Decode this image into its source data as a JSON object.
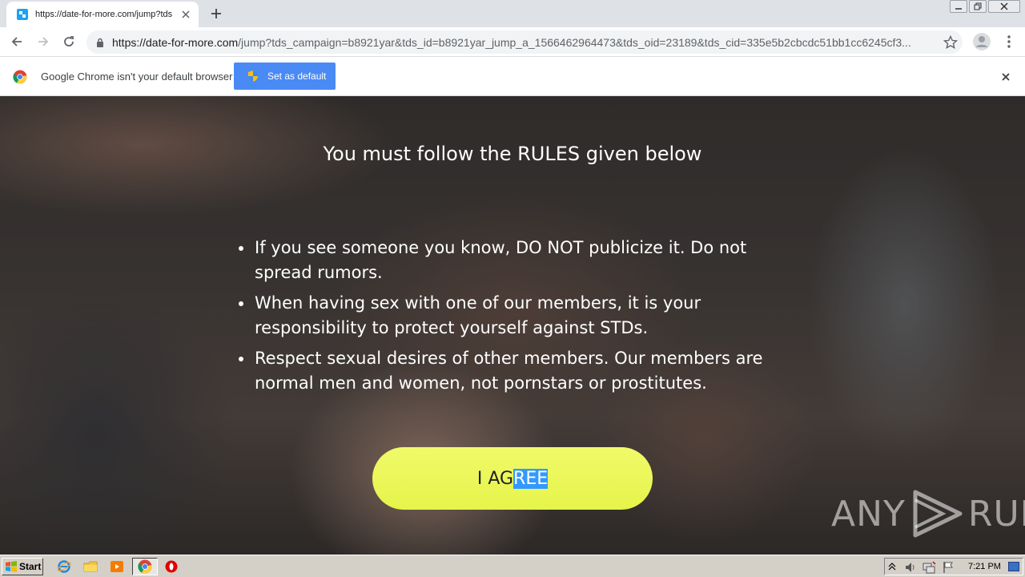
{
  "browser": {
    "tab_title": "https://date-for-more.com/jump?tds",
    "url_host": "https://date-for-more.com",
    "url_path": "/jump?tds_campaign=b8921yar&tds_id=b8921yar_jump_a_1566462964473&tds_oid=23189&tds_cid=335e5b2cbcdc51bb1cc6245cf3..."
  },
  "infobar": {
    "message": "Google Chrome isn't your default browser",
    "button_label": "Set as default"
  },
  "page": {
    "title": "You must follow the RULES given below",
    "rules": [
      "If you see someone you know, DO NOT publicize it. Do not spread rumors.",
      "When having sex with one of our members, it is your responsibility to protect yourself against STDs.",
      "Respect sexual desires of other members. Our members are normal men and women, not pornstars or prostitutes."
    ],
    "agree_button": {
      "plain": "I AG",
      "selected": "REE"
    }
  },
  "watermark": {
    "left": "ANY",
    "right": "RUN"
  },
  "taskbar": {
    "start_label": "Start",
    "clock": "7:21 PM"
  },
  "colors": {
    "accent": "#4a8af4",
    "agree_button": "#e6f44a",
    "selection": "#3399ff"
  }
}
